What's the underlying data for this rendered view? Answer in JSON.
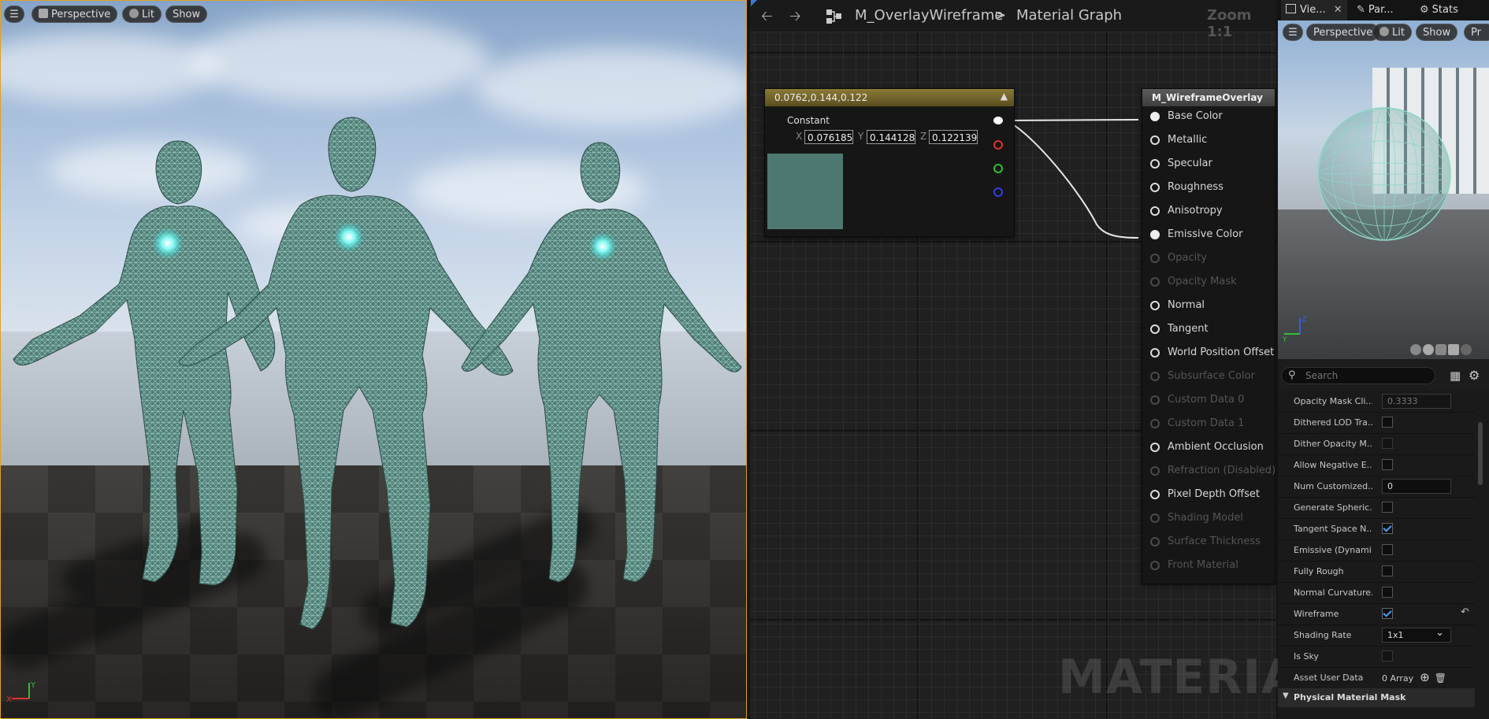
{
  "viewport": {
    "buttons": {
      "perspective": "Perspective",
      "lit": "Lit",
      "show": "Show"
    },
    "axis": {
      "x": "X",
      "y": "Y"
    }
  },
  "graph": {
    "asset_name": "M_OverlayWireframe",
    "separator": ">",
    "graph_name": "Material Graph",
    "zoom": "Zoom 1:1",
    "watermark": "MATERIAL",
    "constant_node": {
      "title": "0.0762,0.144,0.122",
      "label": "Constant",
      "x_label": "X",
      "x_value": "0.076185",
      "y_label": "Y",
      "y_value": "0.144128",
      "z_label": "Z",
      "z_value": "0.122139",
      "swatch_color": "#4f7771"
    },
    "result_node": {
      "title": "M_WireframeOverlay",
      "pins": [
        {
          "label": "Base Color",
          "state": "connected"
        },
        {
          "label": "Metallic",
          "state": "enabled"
        },
        {
          "label": "Specular",
          "state": "enabled"
        },
        {
          "label": "Roughness",
          "state": "enabled"
        },
        {
          "label": "Anisotropy",
          "state": "enabled"
        },
        {
          "label": "Emissive Color",
          "state": "connected"
        },
        {
          "label": "Opacity",
          "state": "disabled"
        },
        {
          "label": "Opacity Mask",
          "state": "disabled"
        },
        {
          "label": "Normal",
          "state": "enabled"
        },
        {
          "label": "Tangent",
          "state": "enabled"
        },
        {
          "label": "World Position Offset",
          "state": "enabled"
        },
        {
          "label": "Subsurface Color",
          "state": "disabled"
        },
        {
          "label": "Custom Data 0",
          "state": "disabled"
        },
        {
          "label": "Custom Data 1",
          "state": "disabled"
        },
        {
          "label": "Ambient Occlusion",
          "state": "enabled"
        },
        {
          "label": "Refraction (Disabled)",
          "state": "disabled"
        },
        {
          "label": "Pixel Depth Offset",
          "state": "enabled"
        },
        {
          "label": "Shading Model",
          "state": "disabled"
        },
        {
          "label": "Surface Thickness",
          "state": "disabled"
        },
        {
          "label": "Front Material",
          "state": "disabled"
        }
      ]
    }
  },
  "right_panel": {
    "tabs": [
      "Vie...",
      "Par...",
      "Stats"
    ],
    "preview_buttons": {
      "perspective": "Perspective",
      "lit": "Lit",
      "show": "Show",
      "more": "Pr"
    },
    "preview_axis": {
      "z": "Z",
      "y": "Y"
    },
    "search_placeholder": "Search",
    "properties": [
      {
        "label": "Opacity Mask Cli...",
        "type": "input",
        "value": "0.3333",
        "dim": true
      },
      {
        "label": "Dithered LOD Tra...",
        "type": "checkbox",
        "checked": false
      },
      {
        "label": "Dither Opacity M...",
        "type": "checkbox",
        "checked": false,
        "dim": true
      },
      {
        "label": "Allow Negative E...",
        "type": "checkbox",
        "checked": false
      },
      {
        "label": "Num Customized...",
        "type": "input",
        "value": "0"
      },
      {
        "label": "Generate Spheric...",
        "type": "checkbox",
        "checked": false
      },
      {
        "label": "Tangent Space N...",
        "type": "checkbox",
        "checked": true
      },
      {
        "label": "Emissive (Dynami...",
        "type": "checkbox",
        "checked": false
      },
      {
        "label": "Fully Rough",
        "type": "checkbox",
        "checked": false
      },
      {
        "label": "Normal Curvature...",
        "type": "checkbox",
        "checked": false
      },
      {
        "label": "Wireframe",
        "type": "checkbox",
        "checked": true,
        "reset": true
      },
      {
        "label": "Shading Rate",
        "type": "dropdown",
        "value": "1x1"
      },
      {
        "label": "Is Sky",
        "type": "checkbox",
        "checked": false,
        "dim": true
      },
      {
        "label": "Asset User Data",
        "type": "array",
        "value": "0 Array"
      }
    ],
    "section": "Physical Material Mask"
  }
}
